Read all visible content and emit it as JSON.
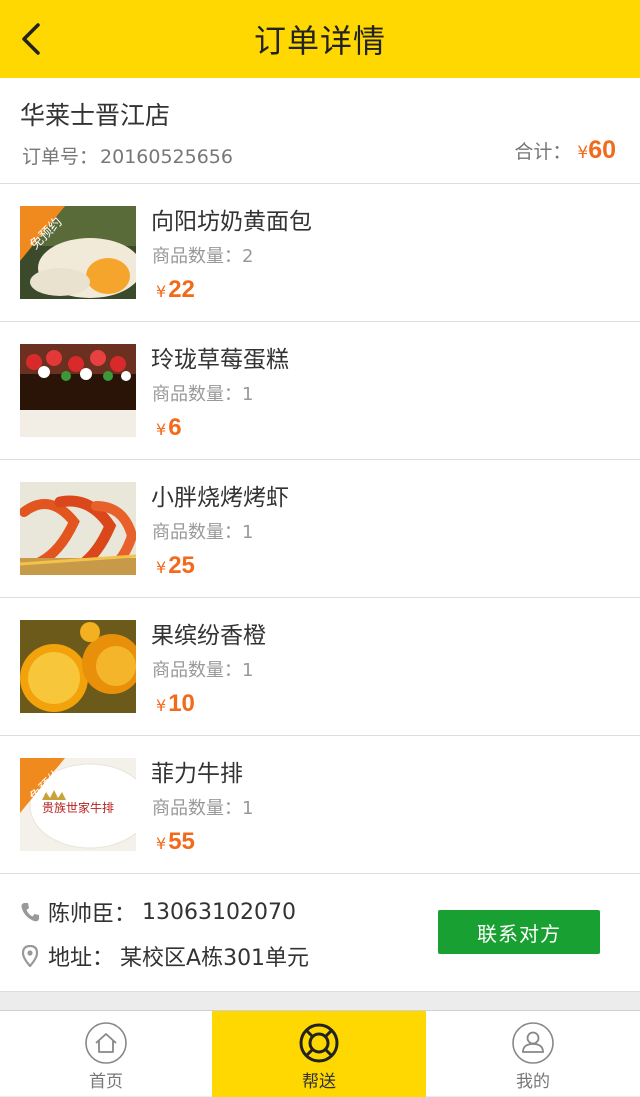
{
  "header": {
    "title": "订单详情",
    "back_icon": "back-chevron-icon"
  },
  "shop": {
    "name": "华莱士晋江店",
    "order_label": "订单号：",
    "order_no": "20160525656",
    "total_label": "合计：",
    "currency": "¥",
    "total": "60"
  },
  "items": [
    {
      "name": "向阳坊奶黄面包",
      "qty_label": "商品数量：",
      "qty": "2",
      "currency": "¥",
      "price": "22",
      "badge": "免预约"
    },
    {
      "name": "玲珑草莓蛋糕",
      "qty_label": "商品数量：",
      "qty": "1",
      "currency": "¥",
      "price": "6"
    },
    {
      "name": "小胖烧烤烤虾",
      "qty_label": "商品数量：",
      "qty": "1",
      "currency": "¥",
      "price": "25"
    },
    {
      "name": "果缤纷香橙",
      "qty_label": "商品数量：",
      "qty": "1",
      "currency": "¥",
      "price": "10"
    },
    {
      "name": "菲力牛排",
      "qty_label": "商品数量：",
      "qty": "1",
      "currency": "¥",
      "price": "55",
      "badge": "免预约",
      "logo_text": "贵族世家牛排"
    }
  ],
  "contact": {
    "person_label": "陈帅臣：",
    "phone": "13063102070",
    "address_label": "地址：",
    "address": "某校区A栋301单元",
    "button": "联系对方",
    "button_color": "#18a032"
  },
  "tabbar": {
    "tabs": [
      {
        "label": "首页",
        "icon": "home-icon"
      },
      {
        "label": "帮送",
        "icon": "lifebuoy-icon",
        "active": true
      },
      {
        "label": "我的",
        "icon": "user-icon"
      }
    ]
  },
  "colors": {
    "accent": "#fed800",
    "price": "#f26a1b"
  }
}
